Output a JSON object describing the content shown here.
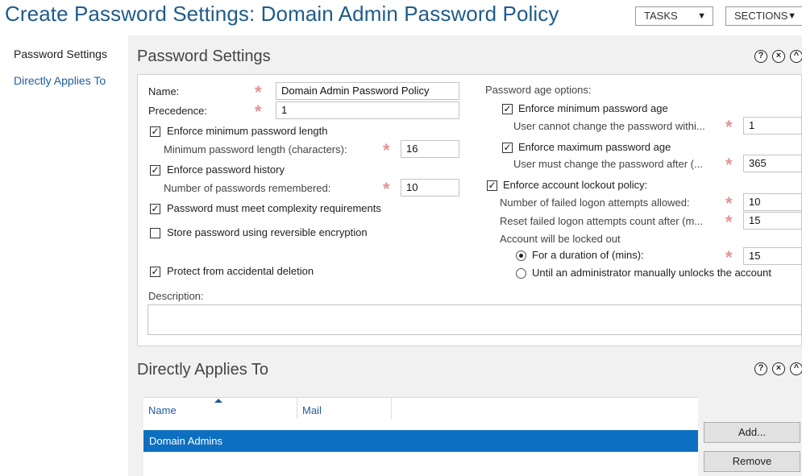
{
  "page_title": "Create Password Settings: Domain Admin Password Policy",
  "header": {
    "tasks_label": "TASKS",
    "sections_label": "SECTIONS"
  },
  "sidebar": {
    "items": [
      {
        "label": "Password Settings"
      },
      {
        "label": "Directly Applies To"
      }
    ]
  },
  "colors": {
    "accent": "#1f5c8a",
    "link": "#1e5c9e",
    "required": "#e49393",
    "selection": "#0d6fbf"
  },
  "icons": {
    "help": "help-icon",
    "close": "close-circle-icon",
    "collapse": "chevron-up-icon",
    "required": "asterisk-icon"
  },
  "password_settings": {
    "title": "Password Settings",
    "name_label": "Name:",
    "name_value": "Domain Admin Password Policy",
    "precedence_label": "Precedence:",
    "precedence_value": "1",
    "enforce_min_length_label": "Enforce minimum password length",
    "enforce_min_length_checked": true,
    "min_length_label": "Minimum password length (characters):",
    "min_length_value": "16",
    "enforce_history_label": "Enforce password history",
    "enforce_history_checked": true,
    "history_label": "Number of passwords remembered:",
    "history_value": "10",
    "complexity_label": "Password must meet complexity requirements",
    "complexity_checked": true,
    "reversible_label": "Store password using reversible encryption",
    "reversible_checked": false,
    "protect_label": "Protect from accidental deletion",
    "protect_checked": true,
    "description_label": "Description:",
    "description_value": "",
    "age_options_label": "Password age options:",
    "enforce_min_age_label": "Enforce minimum password age",
    "enforce_min_age_checked": true,
    "min_age_label": "User cannot change the password withi...",
    "min_age_value": "1",
    "enforce_max_age_label": "Enforce maximum password age",
    "enforce_max_age_checked": true,
    "max_age_label": "User must change the password after (...",
    "max_age_value": "365",
    "lockout_label": "Enforce account lockout policy:",
    "lockout_checked": true,
    "failed_attempts_label": "Number of failed logon attempts allowed:",
    "failed_attempts_value": "10",
    "reset_label": "Reset failed logon attempts count after (m...",
    "reset_value": "15",
    "locked_out_label": "Account will be locked out",
    "duration_label": "For a duration of (mins):",
    "duration_selected": true,
    "duration_value": "15",
    "admin_unlock_label": "Until an administrator manually unlocks the account",
    "admin_unlock_selected": false
  },
  "directly_applies": {
    "title": "Directly Applies To",
    "columns": [
      "Name",
      "Mail"
    ],
    "rows": [
      {
        "name": "Domain Admins",
        "mail": ""
      }
    ],
    "add_label": "Add...",
    "remove_label": "Remove"
  }
}
